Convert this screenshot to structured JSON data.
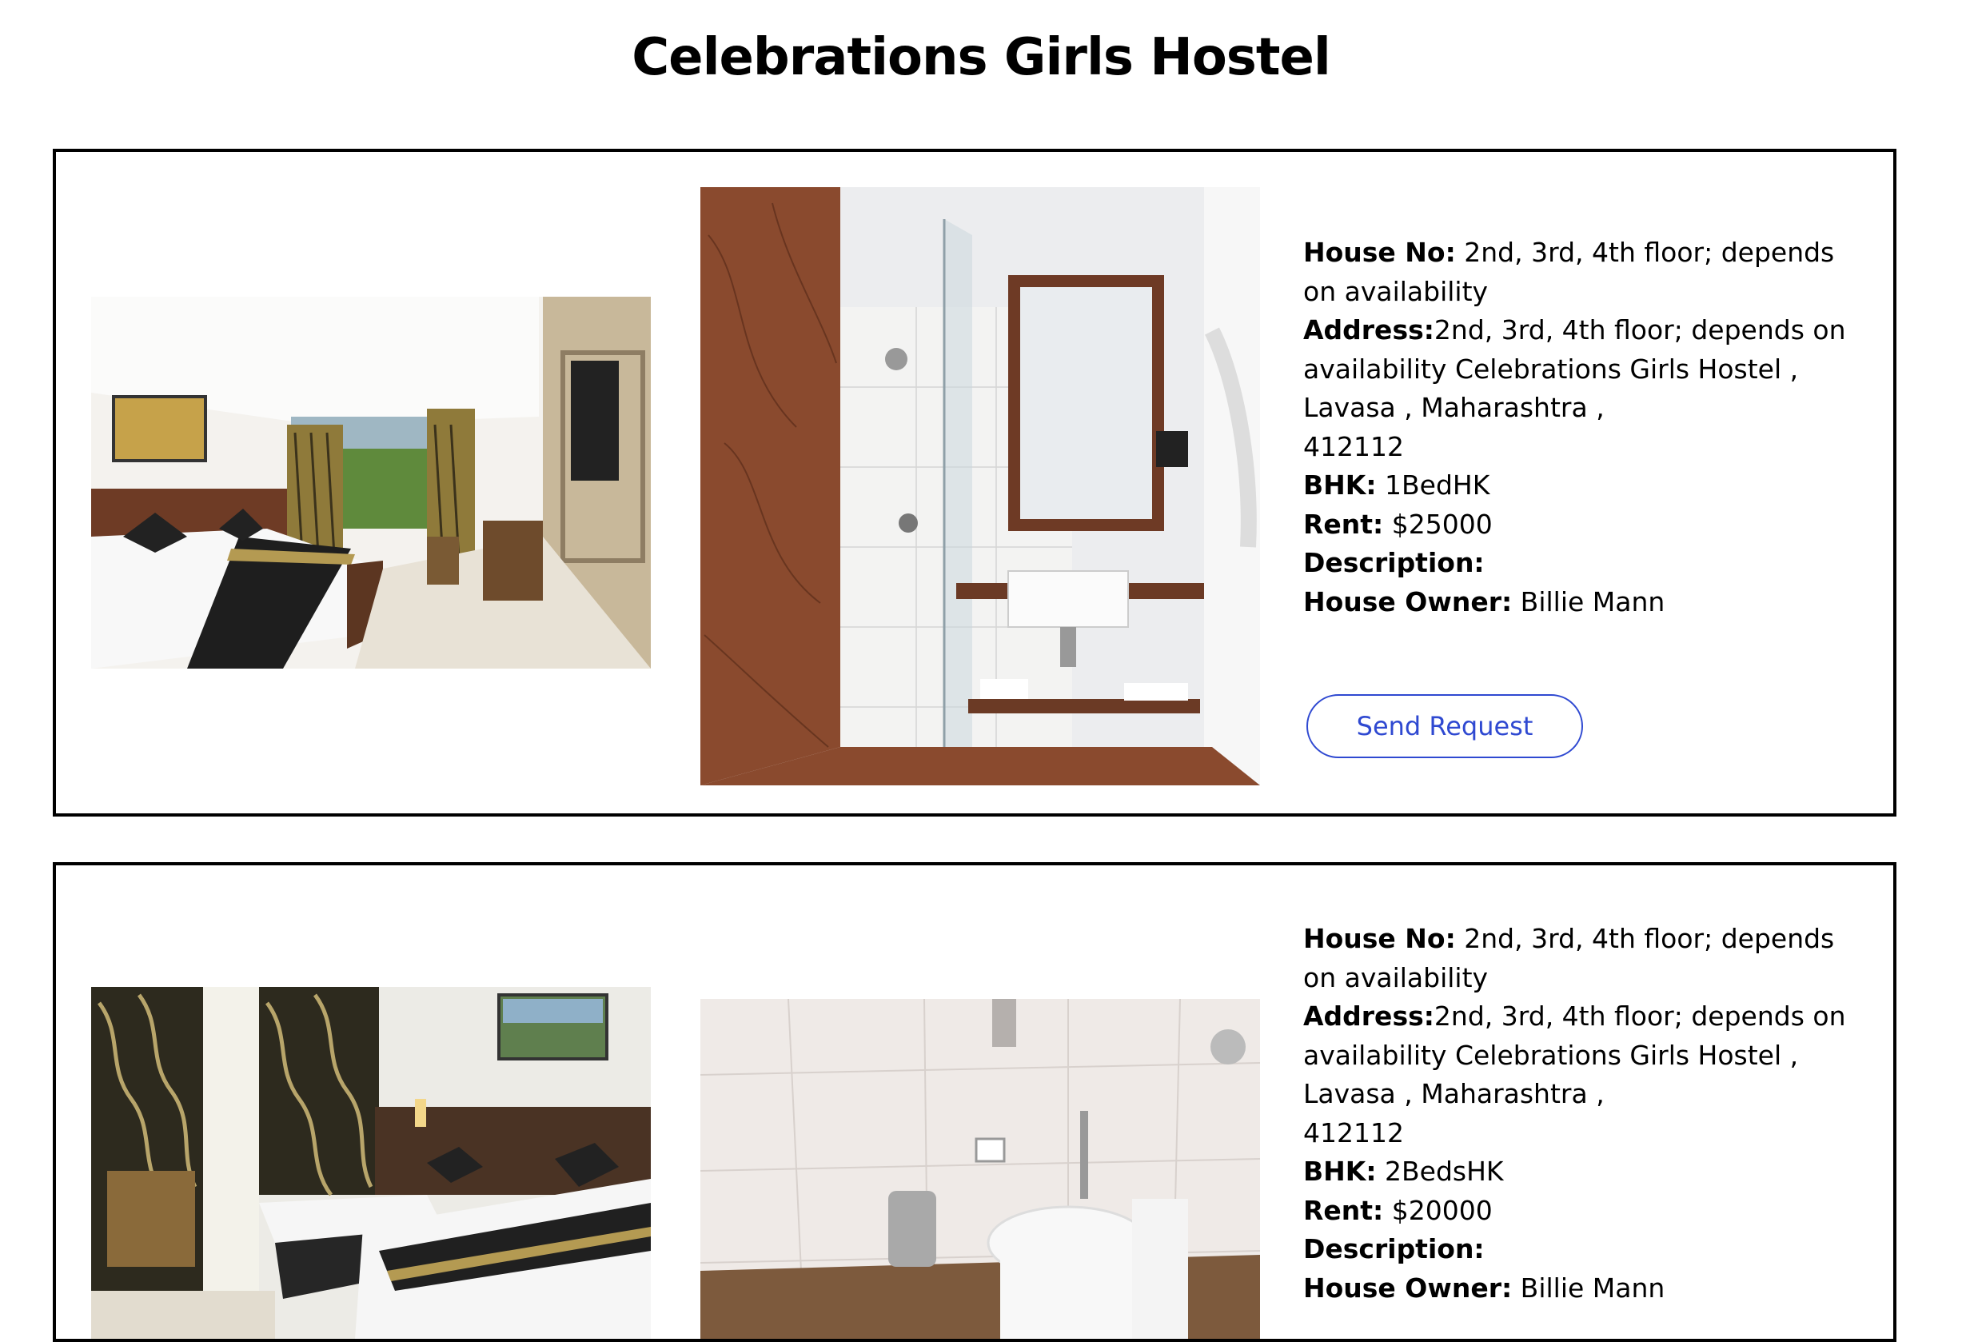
{
  "page": {
    "title": "Celebrations Girls Hostel"
  },
  "listings": [
    {
      "house_no_label": "House No:",
      "house_no": " 2nd, 3rd, 4th floor; depends on availability",
      "address_label": "Address:",
      "address_line1": "2nd, 3rd, 4th floor; depends on availability Celebrations Girls Hostel ,",
      "address_line2": "Lavasa , Maharashtra ,",
      "address_line3": "412112",
      "bhk_label": "BHK:",
      "bhk": " 1BedHK",
      "rent_label": "Rent:",
      "rent": " $25000",
      "description_label": "Description:",
      "description": "",
      "owner_label": "House Owner:",
      "owner": " Billie Mann",
      "button_label": "Send Request",
      "images": [
        "bedroom-photo",
        "bathroom-shower-photo"
      ]
    },
    {
      "house_no_label": "House No:",
      "house_no": " 2nd, 3rd, 4th floor; depends on availability",
      "address_label": "Address:",
      "address_line1": "2nd, 3rd, 4th floor; depends on availability Celebrations Girls Hostel ,",
      "address_line2": "Lavasa , Maharashtra ,",
      "address_line3": "412112",
      "bhk_label": "BHK:",
      "bhk": " 2BedsHK",
      "rent_label": "Rent:",
      "rent": " $20000",
      "description_label": "Description:",
      "description": "",
      "owner_label": "House Owner:",
      "owner": " Billie Mann",
      "images": [
        "twin-bedroom-photo",
        "bathroom-toilet-photo"
      ]
    }
  ],
  "colors": {
    "button_accent": "#2f49d1",
    "card_border": "#000000"
  }
}
